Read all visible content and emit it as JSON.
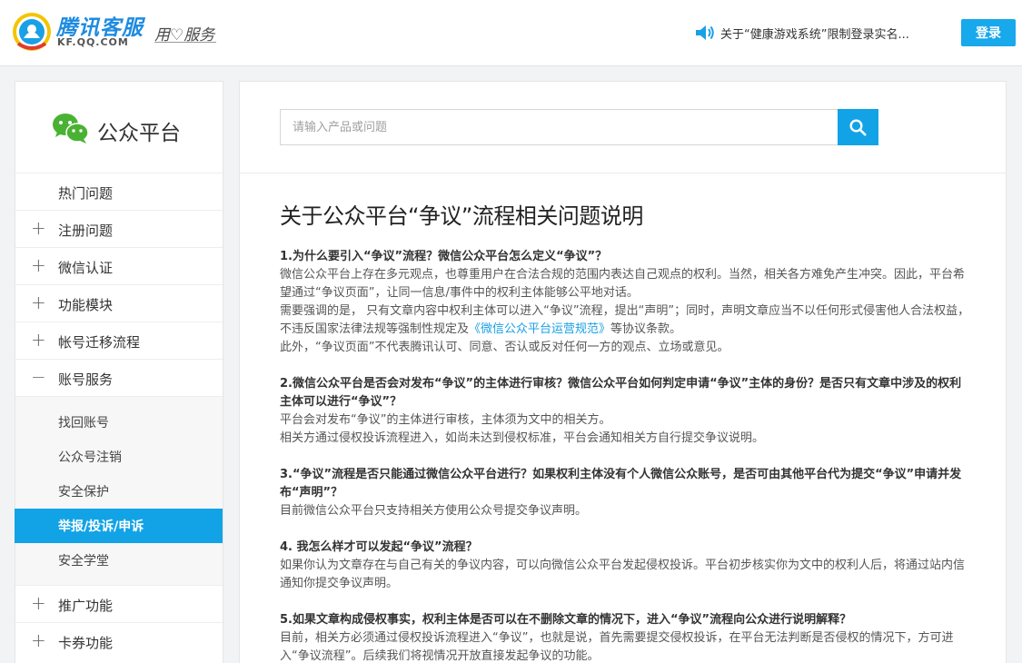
{
  "header": {
    "logo_title": "腾讯客服",
    "logo_sub": "KF.QQ.COM",
    "slogan": "用♡服务",
    "notice": "关于“健康游戏系统”限制登录实名...",
    "login_label": "登录"
  },
  "sidebar": {
    "title": "公众平台",
    "items": [
      {
        "label": "热门问题",
        "icon": "none"
      },
      {
        "label": "注册问题",
        "icon": "plus"
      },
      {
        "label": "微信认证",
        "icon": "plus"
      },
      {
        "label": "功能模块",
        "icon": "plus"
      },
      {
        "label": "帐号迁移流程",
        "icon": "plus"
      },
      {
        "label": "账号服务",
        "icon": "minus"
      }
    ],
    "subitems": [
      {
        "label": "找回账号",
        "active": false
      },
      {
        "label": "公众号注销",
        "active": false
      },
      {
        "label": "安全保护",
        "active": false
      },
      {
        "label": "举报/投诉/申诉",
        "active": true
      },
      {
        "label": "安全学堂",
        "active": false
      }
    ],
    "items_after": [
      {
        "label": "推广功能",
        "icon": "plus"
      },
      {
        "label": "卡券功能",
        "icon": "plus"
      }
    ]
  },
  "search": {
    "placeholder": "请输入产品或问题"
  },
  "article": {
    "title": "关于公众平台“争议”流程相关问题说明",
    "sections": [
      {
        "q": "1.为什么要引入“争议”流程？微信公众平台怎么定义“争议”？",
        "p": [
          "微信公众平台上存在多元观点，也尊重用户在合法合规的范围内表达自己观点的权利。当然，相关各方难免产生冲突。因此，平台希望通过“争议页面”，让同一信息/事件中的权利主体能够公平地对话。",
          "需要强调的是， 只有文章内容中权利主体可以进入“争议”流程，提出“声明”；同时，声明文章应当不以任何形式侵害他人合法权益，不违反国家法律法规等强制性规定及",
          "此外，“争议页面”不代表腾讯认可、同意、否认或反对任何一方的观点、立场或意见。"
        ],
        "link": "《微信公众平台运营规范》",
        "link_after": "等协议条款。"
      },
      {
        "q": "2.微信公众平台是否会对发布“争议”的主体进行审核？微信公众平台如何判定申请“争议”主体的身份？是否只有文章中涉及的权利主体可以进行“争议”？",
        "p": [
          "平台会对发布“争议”的主体进行审核，主体须为文中的相关方。",
          "相关方通过侵权投诉流程进入，如尚未达到侵权标准，平台会通知相关方自行提交争议说明。"
        ]
      },
      {
        "q": "3.“争议”流程是否只能通过微信公众平台进行？如果权利主体没有个人微信公众账号，是否可由其他平台代为提交“争议”申请并发布“声明”？",
        "p": [
          "目前微信公众平台只支持相关方使用公众号提交争议声明。"
        ]
      },
      {
        "q": "4. 我怎么样才可以发起“争议”流程？",
        "p": [
          "如果你认为文章存在与自己有关的争议内容，可以向微信公众平台发起侵权投诉。平台初步核实你为文中的权利人后，将通过站内信通知你提交争议声明。"
        ]
      },
      {
        "q": "5.如果文章构成侵权事实，权利主体是否可以在不删除文章的情况下，进入“争议”流程向公众进行说明解释？",
        "p": [
          "目前，相关方必须通过侵权投诉流程进入“争议”，也就是说，首先需要提交侵权投诉，在平台无法判断是否侵权的情况下，方可进入“争议流程”。后续我们将视情况开放直接发起争议的功能。"
        ]
      }
    ]
  },
  "colors": {
    "accent": "#12a3e6",
    "brand": "#1e8be0",
    "link": "#1aa0e6"
  }
}
